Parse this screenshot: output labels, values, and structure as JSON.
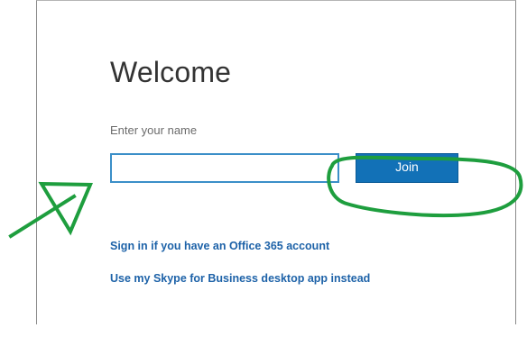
{
  "dialog": {
    "title": "Welcome",
    "name_label": "Enter your name",
    "name_input_value": "",
    "name_input_placeholder": "",
    "join_label": "Join",
    "office365_link": "Sign in if you have an Office 365 account",
    "skype_link": "Use my Skype for Business desktop app instead"
  },
  "colors": {
    "button_bg": "#1271b7",
    "input_border": "#3b8fc8",
    "link": "#1d62a8",
    "annotation": "#1e9e3e"
  },
  "annotations": {
    "arrow_icon": "green-arrow-icon",
    "circle_icon": "green-circle-icon"
  }
}
